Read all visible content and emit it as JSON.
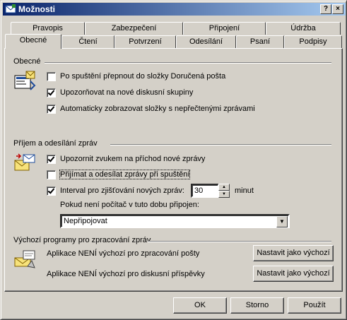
{
  "window": {
    "title": "Možnosti",
    "help_label": "?",
    "close_label": "×"
  },
  "tabs_back": [
    "Pravopis",
    "Zabezpečení",
    "Připojení",
    "Údržba"
  ],
  "tabs_front": [
    "Obecné",
    "Čtení",
    "Potvrzení",
    "Odesílání",
    "Psaní",
    "Podpisy"
  ],
  "sections": {
    "general": {
      "title": "Obecné",
      "options": [
        {
          "label": "Po spuštění přepnout do složky Doručená pošta",
          "checked": false
        },
        {
          "label": "Upozorňovat na nové diskusní skupiny",
          "checked": true
        },
        {
          "label": "Automaticky zobrazovat složky s nepřečtenými zprávami",
          "checked": true
        }
      ]
    },
    "sendrecv": {
      "title": "Příjem a odesílání zpráv",
      "options": [
        {
          "label": "Upozornit zvukem na příchod nové zprávy",
          "checked": true
        },
        {
          "label": "Přijímat a odesílat zprávy při spuštění",
          "checked": false
        },
        {
          "label": "Interval pro zjišťování nových zpráv:",
          "checked": true
        }
      ],
      "interval_value": "30",
      "interval_unit": "minut",
      "offline_label": "Pokud není počítač v tuto dobu připojen:",
      "offline_value": "Nepřipojovat"
    },
    "defaults": {
      "title": "Výchozí programy pro zpracování zpráv",
      "mail_text": "Aplikace NENÍ výchozí pro zpracování pošty",
      "news_text": "Aplikace NENÍ výchozí pro diskusní příspěvky",
      "set_default_label": "Nastavit jako výchozí"
    }
  },
  "buttons": {
    "ok": "OK",
    "cancel": "Storno",
    "apply": "Použít"
  }
}
